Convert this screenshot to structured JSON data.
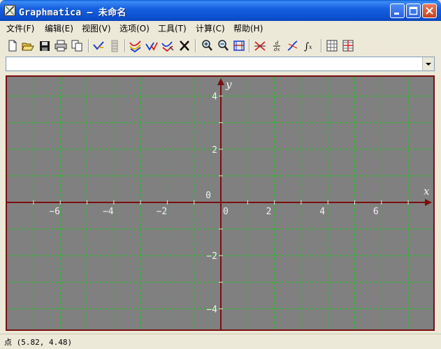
{
  "window": {
    "title": "Graphmatica – 未命名"
  },
  "menu": [
    {
      "label": "文件(F)"
    },
    {
      "label": "编辑(E)"
    },
    {
      "label": "视图(V)"
    },
    {
      "label": "选项(O)"
    },
    {
      "label": "工具(T)"
    },
    {
      "label": "计算(C)"
    },
    {
      "label": "帮助(H)"
    }
  ],
  "toolbar_icons": [
    "new-icon",
    "open-icon",
    "save-icon",
    "print-icon",
    "copy-icon",
    "graph-icon",
    "table-icon",
    "redraw-icon",
    "multi-graph-icon",
    "erase-graph-icon",
    "delete-icon",
    "zoom-in-icon",
    "zoom-out-icon",
    "fit-icon",
    "intersection-icon",
    "derivative-icon",
    "tangent-icon",
    "integral-icon",
    "grid-icon",
    "grid-range-icon"
  ],
  "equation": {
    "value": ""
  },
  "graph": {
    "background": "#808080",
    "axis_color": "#7a0e0e",
    "grid_color": "#19c419",
    "x_label": "x",
    "y_label": "y",
    "x_tick_labels": [
      "−6",
      "−4",
      "−2",
      "0",
      "2",
      "4",
      "6"
    ],
    "y_tick_labels": [
      "4",
      "2",
      "0",
      "−2",
      "−4"
    ],
    "xlim": [
      -8,
      8
    ],
    "ylim": [
      -4.8,
      4.8
    ],
    "grid": true
  },
  "status": {
    "text": "点 (5.82, 4.48)"
  }
}
